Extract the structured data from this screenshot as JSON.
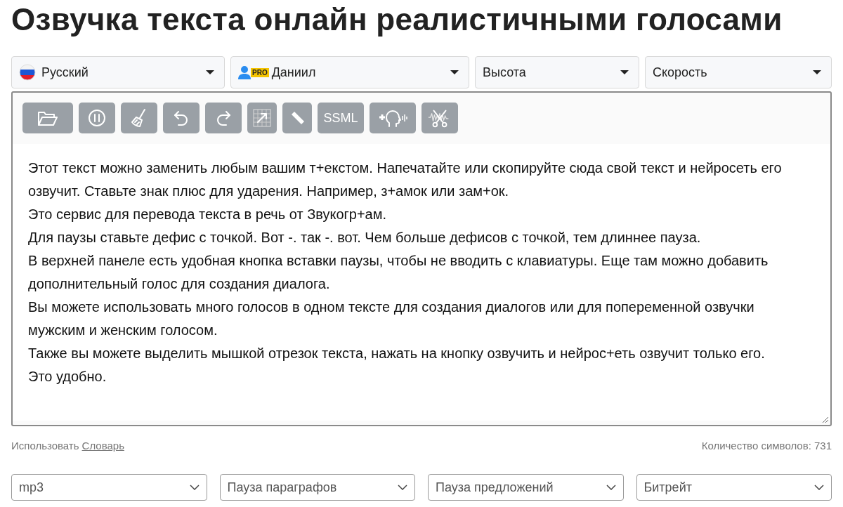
{
  "title": "Озвучка текста онлайн реалистичными голосами",
  "selectors": [
    {
      "kind": "language",
      "label": "Русский"
    },
    {
      "kind": "voice",
      "label": "Даниил",
      "badge": "PRO"
    },
    {
      "kind": "plain",
      "label": "Высота"
    },
    {
      "kind": "plain",
      "label": "Скорость"
    }
  ],
  "toolbar": [
    {
      "kind": "folder"
    },
    {
      "kind": "pause"
    },
    {
      "kind": "broom"
    },
    {
      "kind": "undo"
    },
    {
      "kind": "redo"
    },
    {
      "kind": "grid"
    },
    {
      "kind": "eraser"
    },
    {
      "kind": "text",
      "label": "SSML"
    },
    {
      "kind": "add-voice"
    },
    {
      "kind": "cut-audio"
    }
  ],
  "editor_lines": [
    "Этот текст можно заменить любым вашим т+екстом. Напечатайте или скопируйте сюда свой текст и нейросеть его озвучит. Ставьте знак плюс для ударения. Например, з+амок или зам+ок.",
    "Это сервис для перевода текста в речь от Звукогр+ам.",
    "Для паузы ставьте дефис с точкой. Вот -. так -. вот. Чем больше дефисов с точкой, тем длиннее пауза.",
    "В верхней панеле есть удобная кнопка вставки паузы, чтобы не вводить с клавиатуры. Еще там можно добавить дополнительный голос для создания диалога.",
    "Вы можете использовать много голосов в одном тексте для создания диалогов или для попеременной озвучки мужским и женским голосом.",
    "Также вы можете выделить мышкой отрезок текста, нажать на кнопку озвучить и нейрос+еть озвучит только его. Это удобно."
  ],
  "footer": {
    "use_label": "Использовать",
    "dictionary_link": "Словарь",
    "char_count": "Количество символов: 731"
  },
  "output_selects": [
    "mp3",
    "Пауза параграфов",
    "Пауза предложений",
    "Битрейт"
  ]
}
